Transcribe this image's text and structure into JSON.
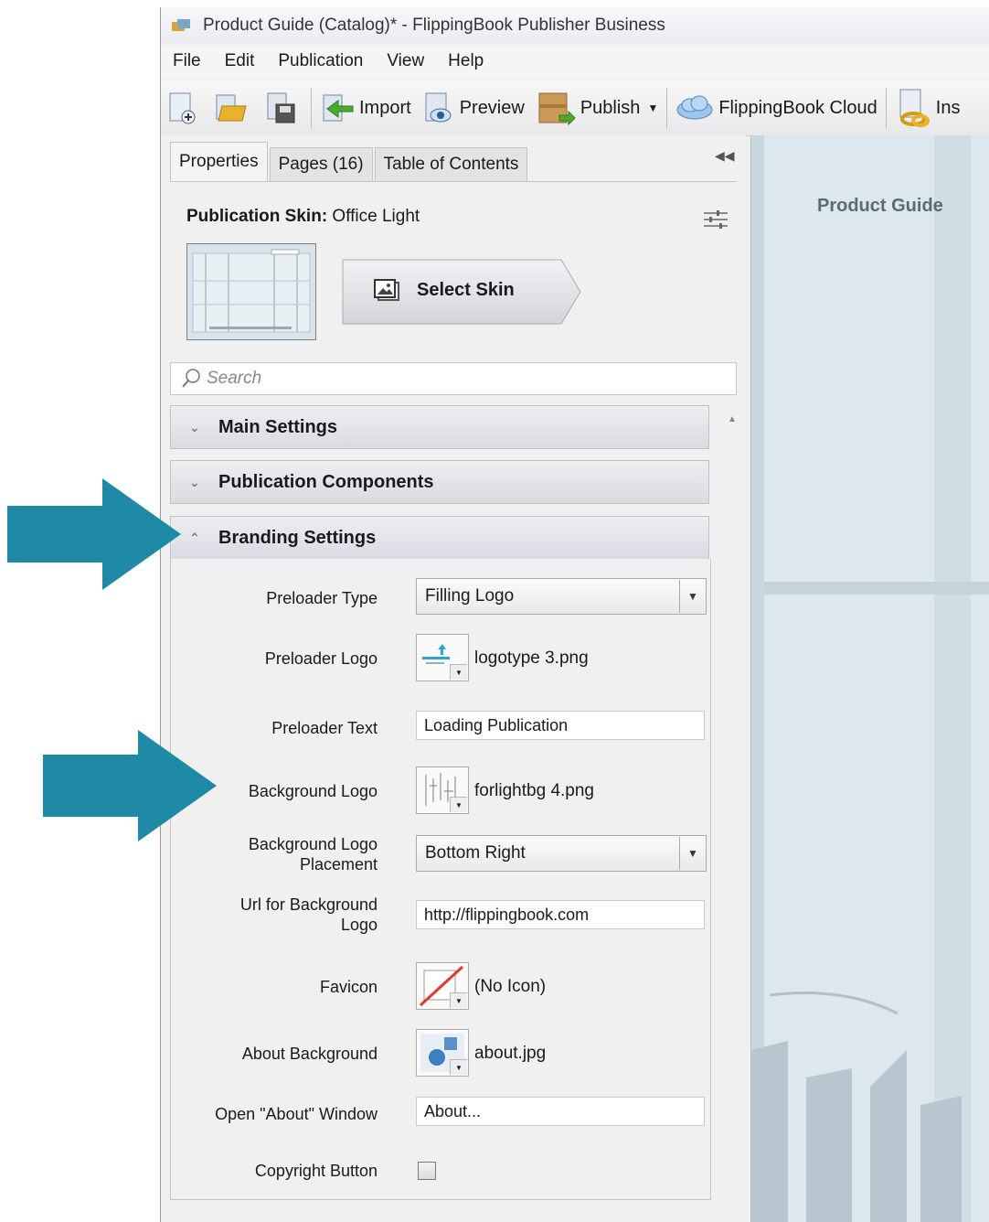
{
  "window": {
    "title": "Product Guide (Catalog)* - FlippingBook Publisher Business"
  },
  "menu": [
    "File",
    "Edit",
    "Publication",
    "View",
    "Help"
  ],
  "toolbar": {
    "import": "Import",
    "preview": "Preview",
    "publish": "Publish",
    "cloud": "FlippingBook Cloud",
    "insert_partial": "Ins"
  },
  "tabs": [
    "Properties",
    "Pages (16)",
    "Table of Contents"
  ],
  "skin": {
    "label": "Publication Skin",
    "value": "Office Light",
    "select_label": "Select Skin"
  },
  "search": {
    "placeholder": "Search"
  },
  "sections": {
    "main": "Main Settings",
    "components": "Publication Components",
    "branding": "Branding Settings"
  },
  "branding": {
    "preloader_type": {
      "label": "Preloader Type",
      "value": "Filling Logo"
    },
    "preloader_logo": {
      "label": "Preloader Logo",
      "value": "logotype 3.png"
    },
    "preloader_text": {
      "label": "Preloader Text",
      "value": "Loading Publication"
    },
    "background_logo": {
      "label": "Background Logo",
      "value": "forlightbg 4.png"
    },
    "bg_logo_placement": {
      "label_line1": "Background Logo",
      "label_line2": "Placement",
      "value": "Bottom Right"
    },
    "bg_logo_url": {
      "label_line1": "Url for Background",
      "label_line2": "Logo",
      "value": "http://flippingbook.com"
    },
    "favicon": {
      "label": "Favicon",
      "value": "(No Icon)"
    },
    "about_background": {
      "label": "About Background",
      "value": "about.jpg"
    },
    "about_window": {
      "label": "Open \"About\" Window",
      "value": "About..."
    },
    "copyright_button": {
      "label": "Copyright Button",
      "checked": false
    }
  },
  "preview": {
    "title": "Product Guide"
  },
  "colors": {
    "callout_arrow": "#1f8aa6"
  }
}
